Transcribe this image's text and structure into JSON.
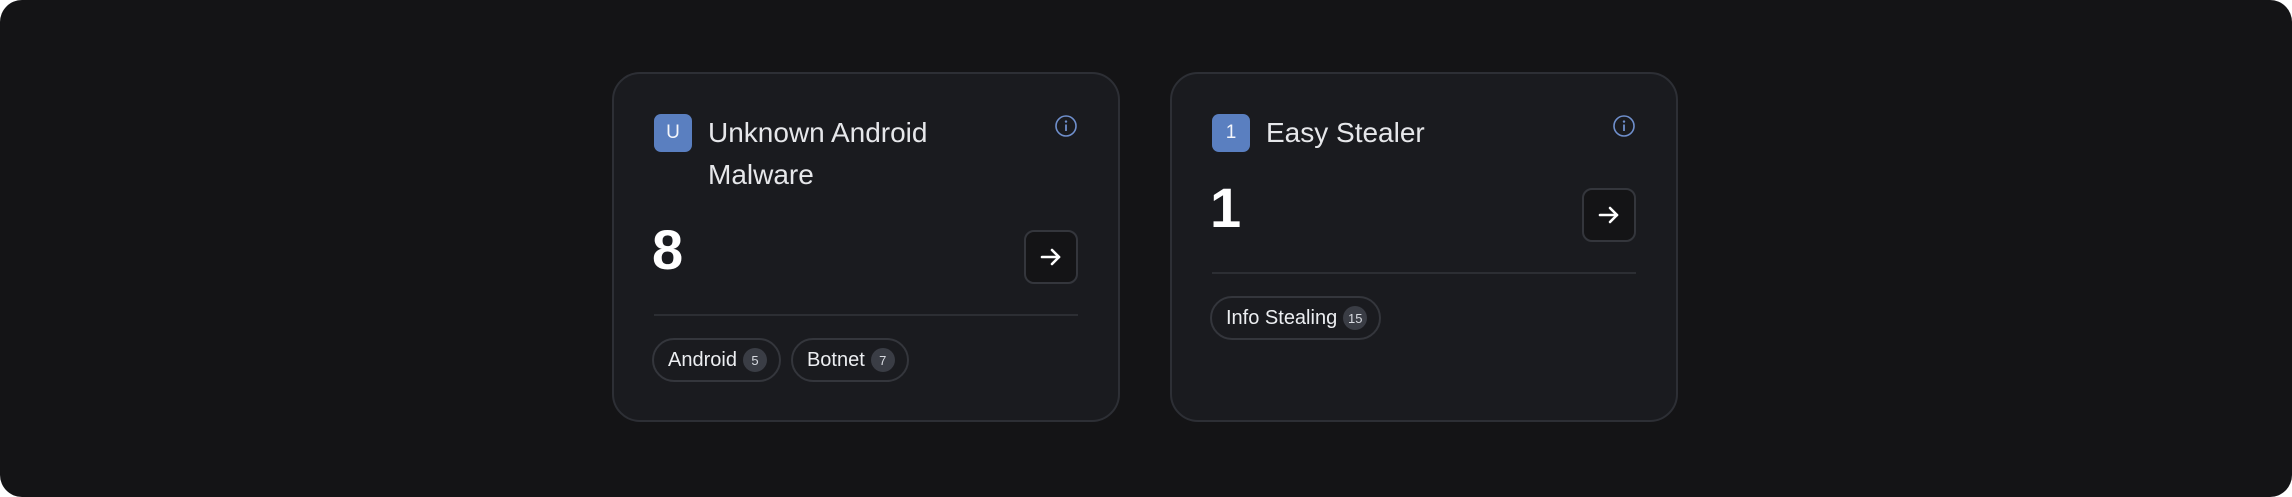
{
  "cards": [
    {
      "badge": "U",
      "title": "Unknown Android Malware",
      "count": "8",
      "icons": {
        "info": "info-icon",
        "arrow": "arrow-right-icon"
      },
      "tags": [
        {
          "label": "Android",
          "count": "5"
        },
        {
          "label": "Botnet",
          "count": "7"
        }
      ]
    },
    {
      "badge": "1",
      "title": "Easy Stealer",
      "count": "1",
      "icons": {
        "info": "info-icon",
        "arrow": "arrow-right-icon"
      },
      "tags": [
        {
          "label": "Info Stealing",
          "count": "15"
        }
      ]
    }
  ],
  "colors": {
    "background": "#141416",
    "card": "#1a1b1f",
    "badge": "#5a7fc0",
    "info_icon": "#6f8fcc"
  }
}
